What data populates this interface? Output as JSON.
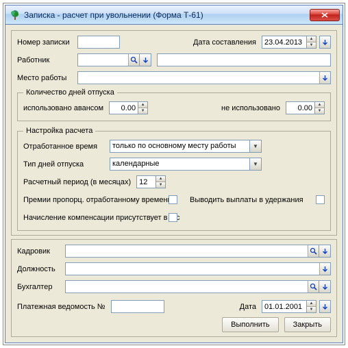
{
  "titlebar": {
    "title": "Записка - расчет при увольнении (Форма Т-61)"
  },
  "top": {
    "note_number_label": "Номер записки",
    "note_number_value": "",
    "compose_date_label": "Дата составления",
    "compose_date_value": "23.04.2013",
    "worker_label": "Работник",
    "worker_value": "",
    "worker_display": "",
    "workplace_label": "Место работы",
    "workplace_value": ""
  },
  "vacation": {
    "legend": "Количество дней отпуска",
    "used_advance_label": "использовано авансом",
    "used_advance_value": "0.00",
    "not_used_label": "не использовано",
    "not_used_value": "0.00"
  },
  "calc": {
    "legend": "Настройка расчета",
    "worked_time_label": "Отработанное время",
    "worked_time_value": "только по основному месту работы",
    "day_type_label": "Тип дней отпуска",
    "day_type_value": "календарные",
    "period_label": "Расчетный период (в месяцах)",
    "period_value": "12",
    "bonus_prop_label": "Премии пропорц. отработанному времени",
    "payouts_to_ded_label": "Выводить выплаты в удержания",
    "comp_present_label": "Начисление компенсации присутствует в л/с"
  },
  "bottom": {
    "kadrovik_label": "Кадровик",
    "kadrovik_value": "",
    "position_label": "Должность",
    "position_value": "",
    "accountant_label": "Бухгалтер",
    "accountant_value": "",
    "payroll_label": "Платежная ведомость №",
    "payroll_value": "",
    "date_label": "Дата",
    "date_value": "01.01.2001",
    "execute_label": "Выполнить",
    "close_label": "Закрыть"
  }
}
